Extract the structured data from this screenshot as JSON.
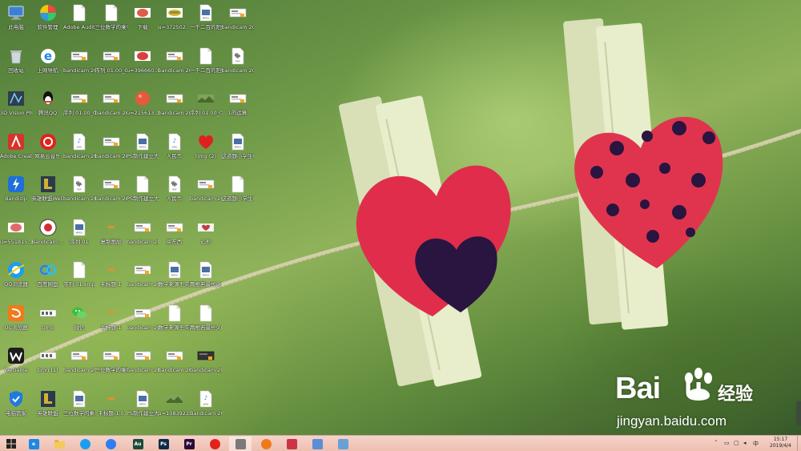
{
  "desktop": {
    "icons": [
      {
        "col": 0,
        "row": 0,
        "label": "此电脑",
        "type": "computer",
        "bg": "#3f7fd0"
      },
      {
        "col": 1,
        "row": 0,
        "label": "软件管理",
        "type": "pinwheel",
        "bg": "#e74c3c"
      },
      {
        "col": 2,
        "row": 0,
        "label": "Adobe Audition C...",
        "type": "doc",
        "bg": "#ffffff"
      },
      {
        "col": 3,
        "row": 0,
        "label": "三位数学的乘积选…",
        "type": "doc",
        "bg": "#ffffff"
      },
      {
        "col": 4,
        "row": 0,
        "label": "下载",
        "type": "thumb-red",
        "bg": "#e05a4a"
      },
      {
        "col": 5,
        "row": 0,
        "label": "u=372502...",
        "type": "thumb-yellow",
        "bg": "#e0b030"
      },
      {
        "col": 6,
        "row": 0,
        "label": "一千二百的阳规建面怎么…",
        "type": "mpeg",
        "bg": "#ffffff"
      },
      {
        "col": 7,
        "row": 0,
        "label": "bandicam 2019-04-0...",
        "type": "video",
        "bg": "#ffffff"
      },
      {
        "col": 0,
        "row": 1,
        "label": "回收站",
        "type": "bin",
        "bg": "#cfd8dc"
      },
      {
        "col": 1,
        "row": 1,
        "label": "上网导航",
        "type": "ie",
        "bg": "#1e88e5"
      },
      {
        "col": 2,
        "row": 1,
        "label": "bandicam 2019-03-3...",
        "type": "video",
        "bg": "#ffffff"
      },
      {
        "col": 3,
        "row": 1,
        "label": "序列 01.00_00_...",
        "type": "video",
        "bg": "#ffffff"
      },
      {
        "col": 4,
        "row": 1,
        "label": "u=396660...",
        "type": "thumb-red",
        "bg": "#d84040"
      },
      {
        "col": 5,
        "row": 1,
        "label": "bandicam 2019-04-0...",
        "type": "video",
        "bg": "#ffffff"
      },
      {
        "col": 6,
        "row": 1,
        "label": "一千二百的阳规建面怎么…",
        "type": "doc",
        "bg": "#ffffff"
      },
      {
        "col": 7,
        "row": 1,
        "label": "bandicam 2019-04-0...",
        "type": "pkf",
        "bg": "#ffffff"
      },
      {
        "col": 0,
        "row": 2,
        "label": "3D Vision Photo V...",
        "type": "3d",
        "bg": "#2c3e50"
      },
      {
        "col": 1,
        "row": 2,
        "label": "腾讯QQ",
        "type": "qq",
        "bg": "#111111"
      },
      {
        "col": 2,
        "row": 2,
        "label": "序列 01.00_00_...",
        "type": "video",
        "bg": "#ffffff"
      },
      {
        "col": 3,
        "row": 2,
        "label": "bandicam 2019-04-0...",
        "type": "video",
        "bg": "#ffffff"
      },
      {
        "col": 4,
        "row": 2,
        "label": "u=215613...",
        "type": "thumb-round",
        "bg": "#e55a3c"
      },
      {
        "col": 5,
        "row": 2,
        "label": "bandicam 2019-04-0...",
        "type": "video",
        "bg": "#ffffff"
      },
      {
        "col": 6,
        "row": 2,
        "label": "序列 01.00_00_...",
        "type": "thumb-green",
        "bg": "#7fa45a"
      },
      {
        "col": 7,
        "row": 2,
        "label": "1的运算",
        "type": "video",
        "bg": "#ffffff"
      },
      {
        "col": 0,
        "row": 3,
        "label": "Adobe Creati...",
        "type": "adobe",
        "bg": "#d6332a"
      },
      {
        "col": 1,
        "row": 3,
        "label": "网易云音乐",
        "type": "netease",
        "bg": "#e2231a"
      },
      {
        "col": 2,
        "row": 3,
        "label": "bandicam 2019-03-3...",
        "type": "wav",
        "bg": "#ffffff"
      },
      {
        "col": 3,
        "row": 3,
        "label": "bandicam 2019-04-0...",
        "type": "video",
        "bg": "#ffffff"
      },
      {
        "col": 4,
        "row": 3,
        "label": "PS制作建立大重复…",
        "type": "mpeg",
        "bg": "#ffffff"
      },
      {
        "col": 5,
        "row": 3,
        "label": "人民币",
        "type": "wav",
        "bg": "#ffffff"
      },
      {
        "col": 6,
        "row": 3,
        "label": "timg (2)",
        "type": "heart",
        "bg": "#e02020"
      },
      {
        "col": 7,
        "row": 3,
        "label": "这道题小学生可以做出来…",
        "type": "mpeg",
        "bg": "#ffffff"
      },
      {
        "col": 0,
        "row": 4,
        "label": "Bandizip",
        "type": "bandizip",
        "bg": "#1e6fd9"
      },
      {
        "col": 1,
        "row": 4,
        "label": "英雄联盟WeGame版",
        "type": "lol",
        "bg": "#2a3a4a"
      },
      {
        "col": 2,
        "row": 4,
        "label": "bandicam 2019-03-3...",
        "type": "pkf",
        "bg": "#ffffff"
      },
      {
        "col": 3,
        "row": 4,
        "label": "bandicam 2019-04-0...",
        "type": "video",
        "bg": "#ffffff"
      },
      {
        "col": 4,
        "row": 4,
        "label": "PS制作建立大重复…",
        "type": "doc",
        "bg": "#ffffff"
      },
      {
        "col": 5,
        "row": 4,
        "label": "人民币",
        "type": "pkf",
        "bg": "#ffffff"
      },
      {
        "col": 6,
        "row": 4,
        "label": "bandicam 2019-04-0...",
        "type": "video",
        "bg": "#ffffff"
      },
      {
        "col": 7,
        "row": 4,
        "label": "这道题小学生可以做出来…",
        "type": "doc",
        "bg": "#ffffff"
      },
      {
        "col": 0,
        "row": 5,
        "label": "u=551815...",
        "type": "thumb-red",
        "bg": "#e06a6a"
      },
      {
        "col": 1,
        "row": 5,
        "label": "Bandicam... - 快捷方式",
        "type": "bandicam",
        "bg": "#ffffff"
      },
      {
        "col": 2,
        "row": 5,
        "label": "序列 01",
        "type": "mpeg",
        "bg": "#ffffff"
      },
      {
        "col": 3,
        "row": 5,
        "label": "复制图层",
        "type": "thumb-small",
        "bg": "#e09030"
      },
      {
        "col": 4,
        "row": 5,
        "label": "bandicam 2019-04-0...",
        "type": "video",
        "bg": "#ffffff"
      },
      {
        "col": 5,
        "row": 5,
        "label": "买东西",
        "type": "video",
        "bg": "#ffffff"
      },
      {
        "col": 6,
        "row": 5,
        "label": "心形",
        "type": "thumb-heart",
        "bg": "#c04040"
      },
      {
        "col": 0,
        "row": 6,
        "label": "QQ浏览器",
        "type": "qqbrowser",
        "bg": "#1a9ef0"
      },
      {
        "col": 1,
        "row": 6,
        "label": "百度网盘",
        "type": "baidupan",
        "bg": "#2d7df6"
      },
      {
        "col": 2,
        "row": 6,
        "label": "序列 01.xmp",
        "type": "doc",
        "bg": "#ffffff"
      },
      {
        "col": 3,
        "row": 6,
        "label": "未标题-1",
        "type": "thumb-small",
        "bg": "#e09030"
      },
      {
        "col": 4,
        "row": 6,
        "label": "bandicam 2019-04-0...",
        "type": "video",
        "bg": "#ffffff"
      },
      {
        "col": 5,
        "row": 6,
        "label": "数学来源于实践要应用…",
        "type": "mpeg",
        "bg": "#ffffff"
      },
      {
        "col": 6,
        "row": 6,
        "label": "两根若最长久时，又怎么…",
        "type": "mpeg",
        "bg": "#ffffff"
      },
      {
        "col": 0,
        "row": 7,
        "label": "UC浏览器",
        "type": "uc",
        "bg": "#f07a1a"
      },
      {
        "col": 1,
        "row": 7,
        "label": "timg",
        "type": "thumb-film",
        "bg": "#ffffff"
      },
      {
        "col": 2,
        "row": 7,
        "label": "微信",
        "type": "wechat",
        "bg": "#3fbf3f"
      },
      {
        "col": 3,
        "row": 7,
        "label": "手标题-1",
        "type": "thumb-small",
        "bg": "#e09030"
      },
      {
        "col": 4,
        "row": 7,
        "label": "bandicam 2019-04-0...",
        "type": "video",
        "bg": "#ffffff"
      },
      {
        "col": 5,
        "row": 7,
        "label": "数学来源于实践要应用…",
        "type": "doc",
        "bg": "#ffffff"
      },
      {
        "col": 6,
        "row": 7,
        "label": "两根若最长久时，又怎么…",
        "type": "doc",
        "bg": "#ffffff"
      },
      {
        "col": 0,
        "row": 8,
        "label": "WeGame",
        "type": "wegame",
        "bg": "#1c1c1c"
      },
      {
        "col": 1,
        "row": 8,
        "label": "timg (1)",
        "type": "thumb-film",
        "bg": "#ffffff"
      },
      {
        "col": 2,
        "row": 8,
        "label": "bandicam 2019-03-3...",
        "type": "video",
        "bg": "#ffffff"
      },
      {
        "col": 3,
        "row": 8,
        "label": "三位数学的乘积选…",
        "type": "video",
        "bg": "#ffffff"
      },
      {
        "col": 4,
        "row": 8,
        "label": "bandicam 2019-04-0...",
        "type": "video",
        "bg": "#ffffff"
      },
      {
        "col": 5,
        "row": 8,
        "label": "bandicam 2019-04-0...",
        "type": "video",
        "bg": "#ffffff"
      },
      {
        "col": 6,
        "row": 8,
        "label": "bandicam 2019-04-0...",
        "type": "video-dark",
        "bg": "#333333"
      },
      {
        "col": 0,
        "row": 9,
        "label": "电脑管家",
        "type": "shield",
        "bg": "#1d7be0"
      },
      {
        "col": 1,
        "row": 9,
        "label": "英雄联盟",
        "type": "lol",
        "bg": "#2a3a4a"
      },
      {
        "col": 2,
        "row": 9,
        "label": "三位数学的乘积选…",
        "type": "mpeg",
        "bg": "#ffffff"
      },
      {
        "col": 3,
        "row": 9,
        "label": "未标题-1.0",
        "type": "thumb-small",
        "bg": "#e09030"
      },
      {
        "col": 4,
        "row": 9,
        "label": "PS制作建立大重复…",
        "type": "mpeg",
        "bg": "#ffffff"
      },
      {
        "col": 5,
        "row": 9,
        "label": "u=1083921...",
        "type": "thumb-green",
        "bg": "#7fa45a"
      },
      {
        "col": 6,
        "row": 9,
        "label": "Bandicam 2019-04-0...",
        "type": "wav",
        "bg": "#ffffff"
      }
    ]
  },
  "watermark": {
    "brand": "Bai",
    "brand_tail": "u",
    "cn": "经验",
    "url": "jingyan.baidu.com"
  },
  "taskbar": {
    "apps": [
      {
        "name": "start",
        "label": "",
        "color": "#1a1a1a"
      },
      {
        "name": "ie",
        "label": "e",
        "color": "#1e88e5"
      },
      {
        "name": "file-explorer",
        "label": "",
        "color": "#e6b33a"
      },
      {
        "name": "qq-browser",
        "label": "",
        "color": "#1a9ef0"
      },
      {
        "name": "baidu-netdisk",
        "label": "",
        "color": "#2d7df6"
      },
      {
        "name": "audition",
        "label": "Au",
        "color": "#1b4a3a"
      },
      {
        "name": "photoshop",
        "label": "Ps",
        "color": "#0f2b4a"
      },
      {
        "name": "premiere",
        "label": "Pr",
        "color": "#2a0a3a"
      },
      {
        "name": "netease-music",
        "label": "",
        "color": "#e2231a"
      },
      {
        "name": "bandicam",
        "label": "",
        "color": "#7a7a7a"
      },
      {
        "name": "uc-browser",
        "label": "",
        "color": "#f07a1a"
      },
      {
        "name": "tool",
        "label": "",
        "color": "#cc3344"
      },
      {
        "name": "paint",
        "label": "",
        "color": "#5a8fd8"
      },
      {
        "name": "notepad",
        "label": "",
        "color": "#6aa0d8"
      }
    ],
    "clock_time": "15:17",
    "clock_date": "2019/4/4",
    "tray_lang": "中"
  },
  "colors": {
    "taskbar_bg": "#f0c6b8",
    "heart_red": "#e02d4c",
    "heart_dark": "#2a1440",
    "clothespin": "#e7ecc8"
  }
}
